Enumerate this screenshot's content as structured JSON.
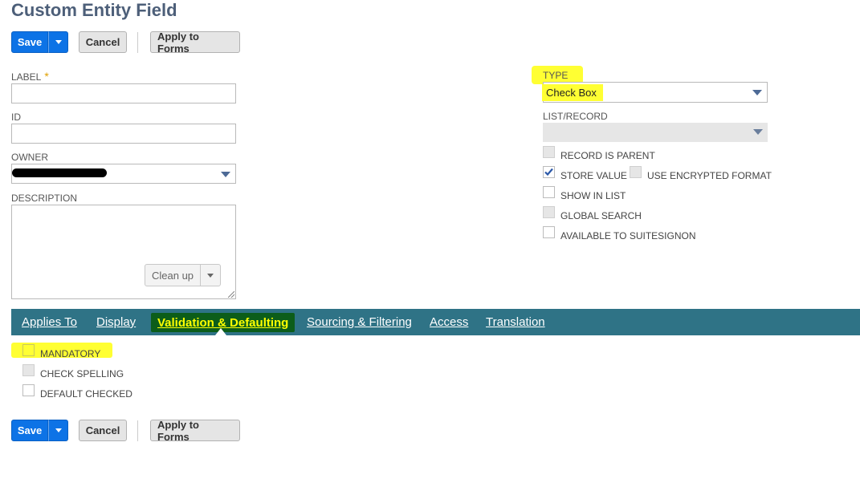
{
  "page": {
    "title": "Custom Entity Field"
  },
  "toolbar": {
    "save_label": "Save",
    "cancel_label": "Cancel",
    "apply_label": "Apply to Forms"
  },
  "fields": {
    "label": {
      "label": "LABEL",
      "required_mark": "*",
      "value": ""
    },
    "id": {
      "label": "ID",
      "value": ""
    },
    "owner": {
      "label": "OWNER",
      "value": ""
    },
    "description": {
      "label": "DESCRIPTION",
      "value": "",
      "cleanup_label": "Clean up"
    },
    "type": {
      "label": "TYPE",
      "value": "Check Box"
    },
    "list_record": {
      "label": "LIST/RECORD",
      "value": ""
    }
  },
  "options": [
    {
      "label": "RECORD IS PARENT",
      "checked": false,
      "disabled": true
    },
    {
      "label": "STORE VALUE",
      "checked": true,
      "disabled": false
    },
    {
      "label": "USE ENCRYPTED FORMAT",
      "checked": false,
      "disabled": true
    },
    {
      "label": "SHOW IN LIST",
      "checked": false,
      "disabled": false
    },
    {
      "label": "GLOBAL SEARCH",
      "checked": false,
      "disabled": true
    },
    {
      "label": "AVAILABLE TO SUITESIGNON",
      "checked": false,
      "disabled": false
    }
  ],
  "tabs": [
    {
      "label": "Applies To"
    },
    {
      "label": "Display"
    },
    {
      "label": "Validation & Defaulting",
      "active": true
    },
    {
      "label": "Sourcing & Filtering"
    },
    {
      "label": "Access"
    },
    {
      "label": "Translation"
    }
  ],
  "validation": [
    {
      "label": "MANDATORY",
      "checked": false
    },
    {
      "label": "CHECK SPELLING",
      "checked": false
    },
    {
      "label": "DEFAULT CHECKED",
      "checked": false
    }
  ],
  "colors": {
    "primary": "#0d73e6",
    "tabbar": "#2f7386",
    "highlight": "#ffff33",
    "title": "#4d5f79"
  }
}
